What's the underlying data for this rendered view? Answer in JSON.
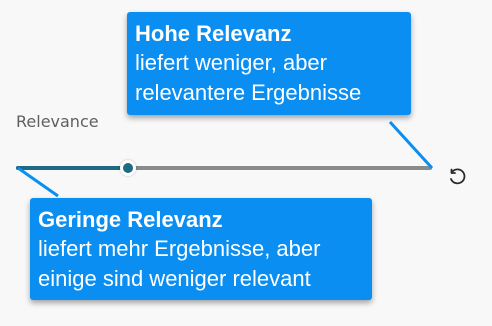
{
  "slider": {
    "label": "Relevance",
    "value_fraction": 0.27,
    "colors": {
      "fill": "#1e6a82",
      "track": "#8a8a8a"
    }
  },
  "reset": {
    "icon": "reset-icon"
  },
  "callouts": {
    "high": {
      "title": "Hohe Relevanz",
      "line1": "liefert weniger, aber",
      "line2": "relevantere Ergebnisse"
    },
    "low": {
      "title": "Geringe Relevanz",
      "line1": "liefert mehr Ergebnisse, aber",
      "line2": "einige sind weniger relevant"
    },
    "color": "#0a8ef1"
  }
}
